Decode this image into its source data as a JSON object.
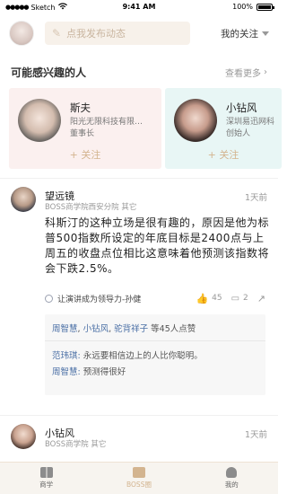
{
  "status_bar": {
    "carrier": "Sketch",
    "time": "9:41 AM",
    "battery": "100%"
  },
  "top_bar": {
    "input_placeholder": "点我发布动态",
    "follow_filter": "我的关注"
  },
  "suggest": {
    "title": "可能感兴趣的人",
    "see_more": "查看更多",
    "people": [
      {
        "name": "斯夫",
        "company": "阳光无限科技有限…",
        "title": "董事长",
        "follow": "+ 关注"
      },
      {
        "name": "小钻风",
        "company": "深圳易迅网科",
        "title": "创始人",
        "follow": "+ 关注"
      }
    ]
  },
  "posts": [
    {
      "name": "望远镜",
      "meta": "BOSS商学院西安分院  其它",
      "time": "1天前",
      "body": "科斯汀的这种立场是很有趣的，原因是他为标普500指数所设定的年底目标是2400点与上周五的收盘点位相比这意味着他预测该指数将会下跌2.5%。",
      "topic": "让演讲成为领导力-孙健",
      "likes": "45",
      "comments": "2",
      "likers": {
        "u1": "周智慧",
        "u2": "小钻风",
        "u3": "驼背祥子",
        "suffix": "等45人点赞"
      },
      "replies": [
        {
          "who": "范玮琪:",
          "text": "永远要相信边上的人比你聪明。"
        },
        {
          "who": "周智慧:",
          "text": "预测得很好"
        }
      ]
    },
    {
      "name": "小钻风",
      "meta": "BOSS商学院  其它",
      "time": "1天前"
    }
  ],
  "tabs": [
    {
      "label": "商学",
      "icon": "book-icon"
    },
    {
      "label": "BOSS圈",
      "icon": "news-icon"
    },
    {
      "label": "我的",
      "icon": "person-icon"
    }
  ],
  "colors": {
    "accent": "#d3b48f",
    "link": "#4a6fa5",
    "card_pink": "#fbf0ef",
    "card_teal": "#e8f6f5"
  }
}
